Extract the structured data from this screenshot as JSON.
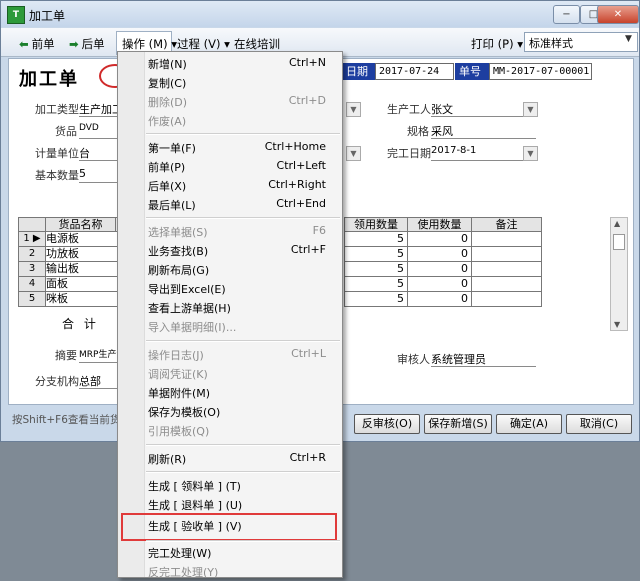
{
  "window": {
    "title": "加工单",
    "icon_label": "T",
    "min_label": "−",
    "max_label": "□",
    "close_label": "✕"
  },
  "toolbar": {
    "prev_label": "前单",
    "next_label": "后单",
    "operate_menu": "操作 (M) ▾",
    "process_menu": "过程 (V) ▾",
    "online_training": "在线培训",
    "print_label": "打印 (P) ▾",
    "style_value": "标准样式"
  },
  "form": {
    "title": "加工单",
    "date_label": "日期",
    "date_value": "2017-07-24",
    "doc_no_label": "单号",
    "doc_no_value": "MM-2017-07-00001",
    "process_type_label": "加工类型",
    "process_type_value": "生产加工",
    "goods_label": "货品",
    "goods_value": "DVD",
    "unit_label": "计量单位",
    "unit_value": "台",
    "base_qty_label": "基本数量",
    "base_qty_value": "5",
    "producer_label": "生产工人",
    "producer_value": "张文",
    "spec_label": "规格",
    "spec_value": "采风",
    "finish_date_label": "完工日期",
    "finish_date_value": "2017-8-1",
    "summary_label": "摘要",
    "summary_value": "MRP生产计",
    "auditor_label": "审核人",
    "auditor_value": "系统管理员",
    "branch_label": "分支机构",
    "branch_value": "总部",
    "total_label": "合 计",
    "hint": "按Shift+F6查看当前货"
  },
  "grid": {
    "headers": [
      "货品名称",
      "领用数量",
      "使用数量",
      "备注"
    ],
    "rows": [
      {
        "num": "1",
        "name": "电源板",
        "received": "5",
        "used": "0"
      },
      {
        "num": "2",
        "name": "功放板",
        "received": "5",
        "used": "0"
      },
      {
        "num": "3",
        "name": "输出板",
        "received": "5",
        "used": "0"
      },
      {
        "num": "4",
        "name": "面板",
        "received": "5",
        "used": "0"
      },
      {
        "num": "5",
        "name": "咪板",
        "received": "5",
        "used": "0"
      }
    ]
  },
  "buttons": {
    "unaudit": "反审核(O)",
    "save_new": "保存新增(S)",
    "ok": "确定(A)",
    "cancel": "取消(C)"
  },
  "menu": {
    "items": [
      {
        "label": "新增(N)",
        "shortcut": "Ctrl+N",
        "disabled": false
      },
      {
        "label": "复制(C)",
        "shortcut": "",
        "disabled": false
      },
      {
        "label": "删除(D)",
        "shortcut": "Ctrl+D",
        "disabled": true
      },
      {
        "label": "作废(A)",
        "shortcut": "",
        "disabled": true
      },
      {
        "label": "第一单(F)",
        "shortcut": "Ctrl+Home",
        "disabled": false
      },
      {
        "label": "前单(P)",
        "shortcut": "Ctrl+Left",
        "disabled": false
      },
      {
        "label": "后单(X)",
        "shortcut": "Ctrl+Right",
        "disabled": false
      },
      {
        "label": "最后单(L)",
        "shortcut": "Ctrl+End",
        "disabled": false
      },
      {
        "label": "选择单据(S)",
        "shortcut": "F6",
        "disabled": true
      },
      {
        "label": "业务查找(B)",
        "shortcut": "Ctrl+F",
        "disabled": false
      },
      {
        "label": "刷新布局(G)",
        "shortcut": "",
        "disabled": false
      },
      {
        "label": "导出到Excel(E)",
        "shortcut": "",
        "disabled": false
      },
      {
        "label": "查看上游单据(H)",
        "shortcut": "",
        "disabled": false
      },
      {
        "label": "导入单据明细(I)...",
        "shortcut": "",
        "disabled": true
      },
      {
        "label": "操作日志(J)",
        "shortcut": "Ctrl+L",
        "disabled": true
      },
      {
        "label": "调阅凭证(K)",
        "shortcut": "",
        "disabled": true
      },
      {
        "label": "单据附件(M)",
        "shortcut": "",
        "disabled": false
      },
      {
        "label": "保存为模板(O)",
        "shortcut": "",
        "disabled": false
      },
      {
        "label": "引用模板(Q)",
        "shortcut": "",
        "disabled": true
      },
      {
        "label": "刷新(R)",
        "shortcut": "Ctrl+R",
        "disabled": false
      },
      {
        "label": "生成 [ 领料单 ] (T)",
        "shortcut": "",
        "disabled": false
      },
      {
        "label": "生成 [ 退料单 ] (U)",
        "shortcut": "",
        "disabled": false
      },
      {
        "label": "生成 [ 验收单 ] (V)",
        "shortcut": "",
        "disabled": false
      },
      {
        "label": "完工处理(W)",
        "shortcut": "",
        "disabled": false
      },
      {
        "label": "反完工处理(Y)",
        "shortcut": "",
        "disabled": true
      }
    ]
  },
  "colors": {
    "highlight_border": "#e03a3a",
    "header_blue": "#1d3ea0"
  }
}
